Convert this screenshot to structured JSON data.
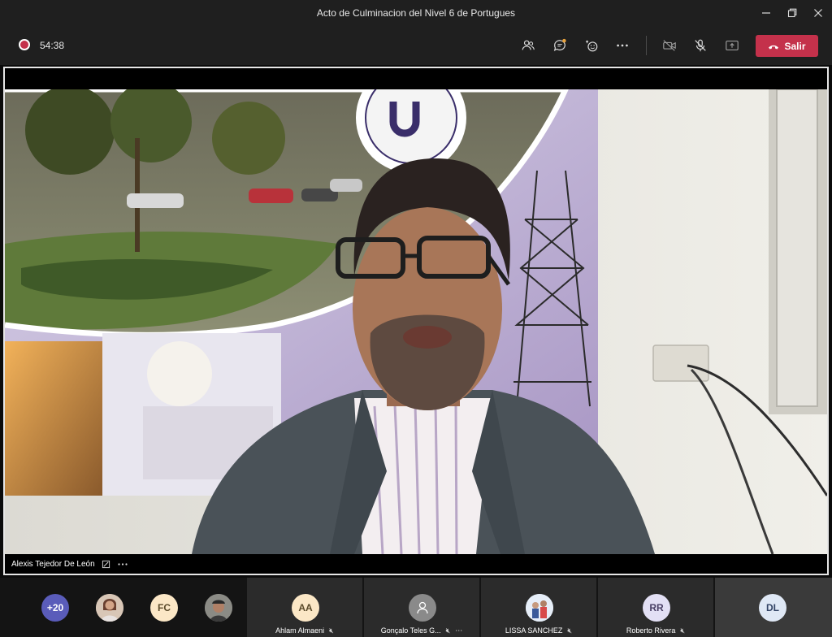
{
  "window": {
    "title": "Acto de Culminacion del Nivel 6 de Portugues"
  },
  "toolbar": {
    "timer": "54:38",
    "leave_label": "Salir",
    "icons": [
      "people-icon",
      "chat-icon",
      "reactions-icon",
      "more-icon",
      "camera-off-icon",
      "mic-off-icon",
      "share-icon"
    ],
    "leave_color": "#c4314b"
  },
  "main_video": {
    "speaker_name": "Alexis Tejedor De León"
  },
  "participants": {
    "overflow_count": "+20",
    "avatars": [
      {
        "initials": "FC",
        "bg": "#fbe7c6",
        "fg": "#5a4a2a"
      },
      {
        "initials": "AA",
        "bg": "#fbe7c6",
        "fg": "#5a4a2a"
      },
      {
        "initials": "RR",
        "bg": "#e3e0f5",
        "fg": "#4a4066"
      },
      {
        "initials": "DL",
        "bg": "#dfe8f5",
        "fg": "#334466"
      }
    ],
    "tiles": [
      {
        "name": "Ahlam Almaeni"
      },
      {
        "name": "Gonçalo Teles G..."
      },
      {
        "name": "LISSA SANCHEZ"
      },
      {
        "name": "Roberto Rivera"
      }
    ]
  }
}
